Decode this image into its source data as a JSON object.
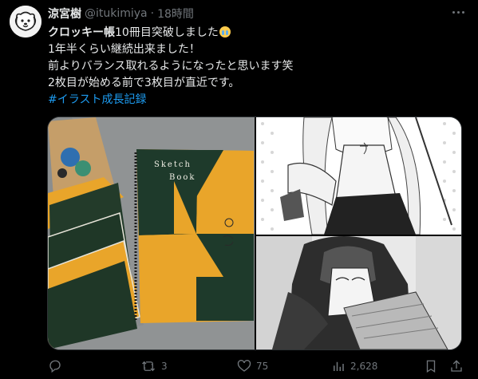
{
  "user": {
    "display_name": "涼宮樹",
    "handle": "@itukimiya",
    "separator": "·",
    "time": "18時間"
  },
  "post": {
    "line1_bold": "クロッキー帳",
    "line1_rest": "10冊目突破しました",
    "line2": "1年半くらい継続出来ました！",
    "line3": "前よりバランス取れるようになったと思います笑",
    "line4": "2枚目が始める前で3枚目が直近です。",
    "hashtag": "#イラスト成長記録",
    "emoji": "loudly-crying-face"
  },
  "media": {
    "sketchbook_label": [
      "Sketch",
      "Book"
    ]
  },
  "actions": {
    "reply_count": "",
    "retweet_count": "3",
    "like_count": "75",
    "views_count": "2,628"
  },
  "colors": {
    "background": "#000000",
    "text": "#e7e9ea",
    "muted": "#71767b",
    "link": "#1d9bf0",
    "border": "#2f3336"
  }
}
